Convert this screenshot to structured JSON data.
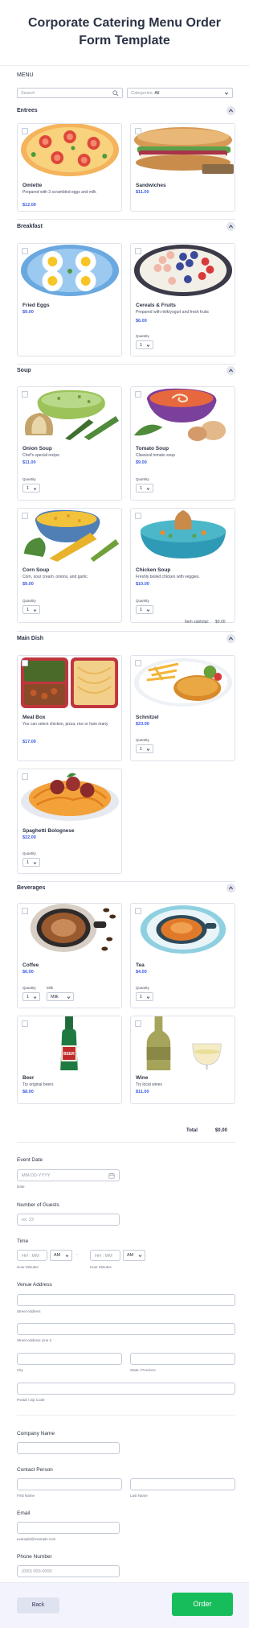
{
  "title_line1": "Corporate Catering Menu Order",
  "title_line2": "Form Template",
  "menu_label": "MENU",
  "search": {
    "placeholder": "Search"
  },
  "categories_select": {
    "label": "Categories:",
    "value": "All"
  },
  "categories": {
    "entrees": "Entrees",
    "breakfast": "Breakfast",
    "soup": "Soup",
    "main_dish": "Main Dish",
    "beverages": "Beverages"
  },
  "products": {
    "omlette": {
      "name": "Omlette",
      "desc": "Prepared with 3 scrambled eggs and milk",
      "price": "$12.00"
    },
    "sandwiches": {
      "name": "Sandwiches",
      "price": "$11.00"
    },
    "fried_eggs": {
      "name": "Fried Eggs",
      "price": "$9.00"
    },
    "cereals": {
      "name": "Cereals & Fruits",
      "desc": "Prepared with milk/yogurt and fresh fruits",
      "price": "$6.00",
      "qty_label": "Quantity",
      "qty": "1"
    },
    "onion_soup": {
      "name": "Onion Soup",
      "desc": "Chef's special recipe",
      "price": "$11.00",
      "qty_label": "Quantity",
      "qty": "1"
    },
    "tomato_soup": {
      "name": "Tomato Soup",
      "desc": "Classical tomato soup",
      "price": "$9.00",
      "qty_label": "Quantity",
      "qty": "1"
    },
    "corn_soup": {
      "name": "Corn Soup",
      "desc": "Corn, sour cream, onions, and garlic.",
      "price": "$9.00",
      "qty_label": "Quantity",
      "qty": "1"
    },
    "chicken_soup": {
      "name": "Chicken Soup",
      "desc": "Freshly boiled chicken with veggies.",
      "price": "$10.00",
      "qty_label": "Quantity",
      "qty": "1"
    },
    "meal_box": {
      "name": "Meal Box",
      "desc": "You can select chicken, pizza, rice or ham many",
      "price": "$17.00"
    },
    "schnitzel": {
      "name": "Schnitzel",
      "price": "$23.00",
      "qty_label": "Quantity",
      "qty": "1"
    },
    "spaghetti": {
      "name": "Spaghetti Bolognese",
      "price": "$22.00",
      "qty_label": "Quantity",
      "qty": "1"
    },
    "coffee": {
      "name": "Coffee",
      "price": "$6.00",
      "qty_label": "Quantity",
      "qty": "1",
      "milk_label": "Milk",
      "milk": "Milk"
    },
    "tea": {
      "name": "Tea",
      "price": "$4.00",
      "qty_label": "Quantity",
      "qty": "1"
    },
    "beer": {
      "name": "Beer",
      "desc": "Try original beers",
      "price": "$8.00"
    },
    "wine": {
      "name": "Wine",
      "desc": "Try local wines",
      "price": "$11.00"
    }
  },
  "item_subtotal": {
    "label": "Item subtotal:",
    "value": "$0.00"
  },
  "total": {
    "label": "Total",
    "value": "$0.00"
  },
  "event_date": {
    "label": "Event Date",
    "placeholder": "MM-DD-YYYY",
    "sub": "Date"
  },
  "guests": {
    "label": "Number of Guests",
    "placeholder": "ex: 23"
  },
  "time": {
    "label": "Time",
    "hh": "HH : MM",
    "ampm": "AM",
    "colon": "-",
    "sub1": "Hour Minutes",
    "sub2": "Hour Minutes"
  },
  "venue": {
    "label": "Venue Address",
    "street": "Street Address",
    "street2": "Street Address Line 2",
    "city": "City",
    "state": "State / Province",
    "zip": "Postal / Zip Code"
  },
  "company": {
    "label": "Company Name"
  },
  "contact": {
    "label": "Contact Person",
    "first": "First Name",
    "last": "Last Name"
  },
  "email": {
    "label": "Email",
    "sub": "example@example.com"
  },
  "phone": {
    "label": "Phone Number",
    "placeholder": "(000) 000-0000"
  },
  "buttons": {
    "back": "Back",
    "order": "Order"
  }
}
